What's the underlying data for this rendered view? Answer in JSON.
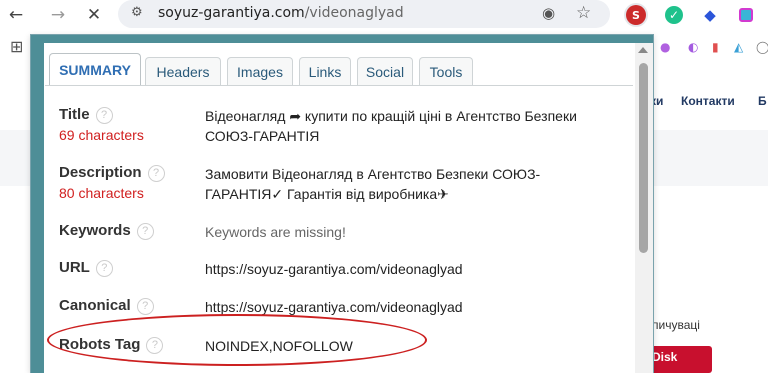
{
  "browser": {
    "nav": {
      "back_icon": "←",
      "forward_icon": "→",
      "close_icon": "✕"
    },
    "address_bar": {
      "domain": "soyuz-garantiya.com",
      "path": "/videonaglyad"
    },
    "extensions": {
      "seo_badge": "S",
      "check_icon": "✓",
      "tag_icon": "◆"
    },
    "bookmarks": {
      "apps_icon": "⊞"
    }
  },
  "webpage": {
    "nav_links": [
      "ки",
      "Контакти",
      "Б"
    ],
    "snippet": "пичуваці",
    "badge": "Disk"
  },
  "seo_popup": {
    "tabs": [
      {
        "label": "SUMMARY",
        "active": true
      },
      {
        "label": "Headers",
        "active": false
      },
      {
        "label": "Images",
        "active": false
      },
      {
        "label": "Links",
        "active": false
      },
      {
        "label": "Social",
        "active": false
      },
      {
        "label": "Tools",
        "active": false
      }
    ],
    "help_glyph": "?",
    "rows": {
      "title": {
        "label": "Title",
        "sub": "69 characters",
        "value": "Відеонагляд ➦ купити по кращій ціні в Агентство Безпеки СОЮЗ-ГАРАНТІЯ"
      },
      "description": {
        "label": "Description",
        "sub": "80 characters",
        "value": "Замовити Відеонагляд в Агентство Безпеки СОЮЗ-ГАРАНТІЯ✓ Гарантія від виробника✈"
      },
      "keywords": {
        "label": "Keywords",
        "value": "Keywords are missing!"
      },
      "url": {
        "label": "URL",
        "value": "https://soyuz-garantiya.com/videonaglyad"
      },
      "canonical": {
        "label": "Canonical",
        "value": "https://soyuz-garantiya.com/videonaglyad"
      },
      "robots": {
        "label": "Robots Tag",
        "value": "NOINDEX,NOFOLLOW"
      }
    }
  },
  "colors": {
    "frame": "#4e8e97",
    "active_tab_text": "#2f6eb3",
    "char_count": "#d12020",
    "highlight_ring": "#cc2020",
    "nav_link": "#223a63",
    "badge_bg": "#c8102e"
  }
}
